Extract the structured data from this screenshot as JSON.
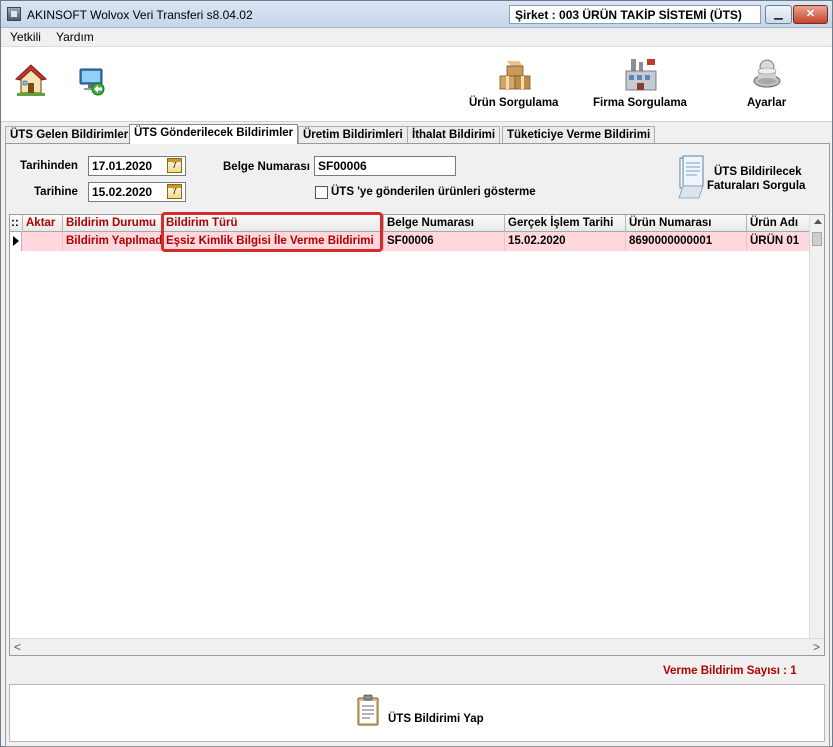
{
  "window": {
    "title": "AKINSOFT Wolvox Veri Transferi s8.04.02",
    "company": "Şirket : 003 ÜRÜN TAKİP SİSTEMİ (ÜTS)",
    "minimize_glyph": "▁",
    "close_glyph": "✕"
  },
  "menu": [
    "Yetkili",
    "Yardım"
  ],
  "toolbar": {
    "home_icon": "home-icon",
    "transfer_icon": "network-transfer-icon",
    "urun_sorgulama": "Ürün Sorgulama",
    "firma_sorgulama": "Firma Sorgulama",
    "ayarlar": "Ayarlar"
  },
  "tabs": [
    "ÜTS Gelen Bildirimler",
    "ÜTS Gönderilecek Bildirimler",
    "Üretim Bildirimleri",
    "İthalat Bildirimi",
    "Tüketiciye Verme Bildirimi"
  ],
  "active_tab": 1,
  "filters": {
    "tarihinden_label": "Tarihinden",
    "tarihinden_value": "17.01.2020",
    "tarihine_label": "Tarihine",
    "tarihine_value": "15.02.2020",
    "calendar_glyph": "7",
    "belge_label": "Belge Numarası",
    "belge_value": "SF00006",
    "checkbox_label": "ÜTS 'ye gönderilen ürünleri gösterme",
    "sorgula_line1": "ÜTS Bildirilecek",
    "sorgula_line2": "Faturaları Sorgula"
  },
  "grid": {
    "corner": "::",
    "columns": [
      "Aktar",
      "Bildirim Durumu",
      "Bildirim Türü",
      "Belge Numarası",
      "Gerçek İşlem Tarihi",
      "Ürün Numarası",
      "Ürün Adı"
    ],
    "rows": [
      {
        "aktar": "",
        "durum": "Bildirim Yapılmadı",
        "tur": "Eşsiz Kimlik Bilgisi İle Verme Bildirimi",
        "belge": "SF00006",
        "tarih": "15.02.2020",
        "urun_no": "8690000000001",
        "urun_adi": "ÜRÜN 01"
      }
    ],
    "hscroll_left": "<",
    "hscroll_right": ">"
  },
  "summary": "Verme Bildirim Sayısı : 1",
  "footer": {
    "send_label": "ÜTS Bildirimi Yap"
  },
  "colors": {
    "accent_red": "#b00000",
    "row_highlight": "#ffd7dc",
    "annotation": "#d42c2c"
  }
}
